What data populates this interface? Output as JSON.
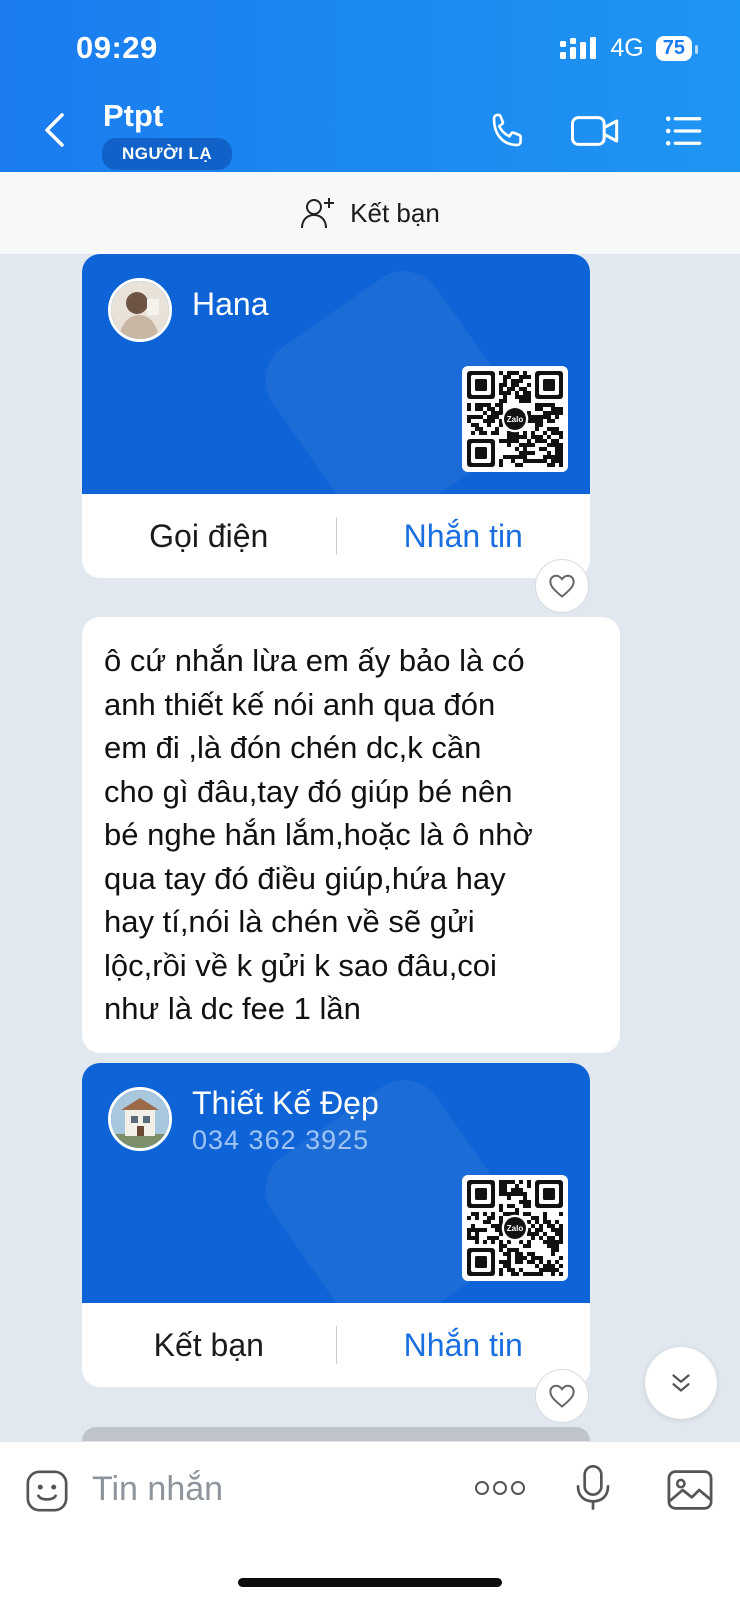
{
  "status": {
    "time": "09:29",
    "network": "4G",
    "battery": "75"
  },
  "header": {
    "title": "Ptpt",
    "badge": "NGƯỜI LẠ"
  },
  "add_friend_bar": {
    "label": "Kết bạn"
  },
  "cards": [
    {
      "name": "Hana",
      "phone": "",
      "left_action": "Gọi điện",
      "right_action": "Nhắn tin",
      "qr_label": "Zalo"
    },
    {
      "name": "Thiết Kế Đẹp",
      "phone": "034 362 3925",
      "left_action": "Kết bạn",
      "right_action": "Nhắn tin",
      "qr_label": "Zalo"
    }
  ],
  "message": {
    "lines": [
      "ô cứ nhắn lừa em ấy bảo là có",
      "anh thiết kế nói anh qua đón",
      "em đi ,là đón chén dc,k cần",
      "cho gì đâu,tay đó giúp bé nên",
      "bé nghe hắn lắm,hoặc là ô nhờ",
      "qua tay đó điều giúp,hứa hay",
      "hay tí,nói là chén về sẽ gửi",
      "lộc,rồi về k gửi k sao đâu,coi",
      "như là dc fee 1 lần"
    ]
  },
  "composer": {
    "placeholder": "Tin nhắn"
  },
  "colors": {
    "header": "#1a7cf0",
    "card": "#0e63d6",
    "link": "#1a6fe0",
    "background": "#e2e8ef"
  }
}
